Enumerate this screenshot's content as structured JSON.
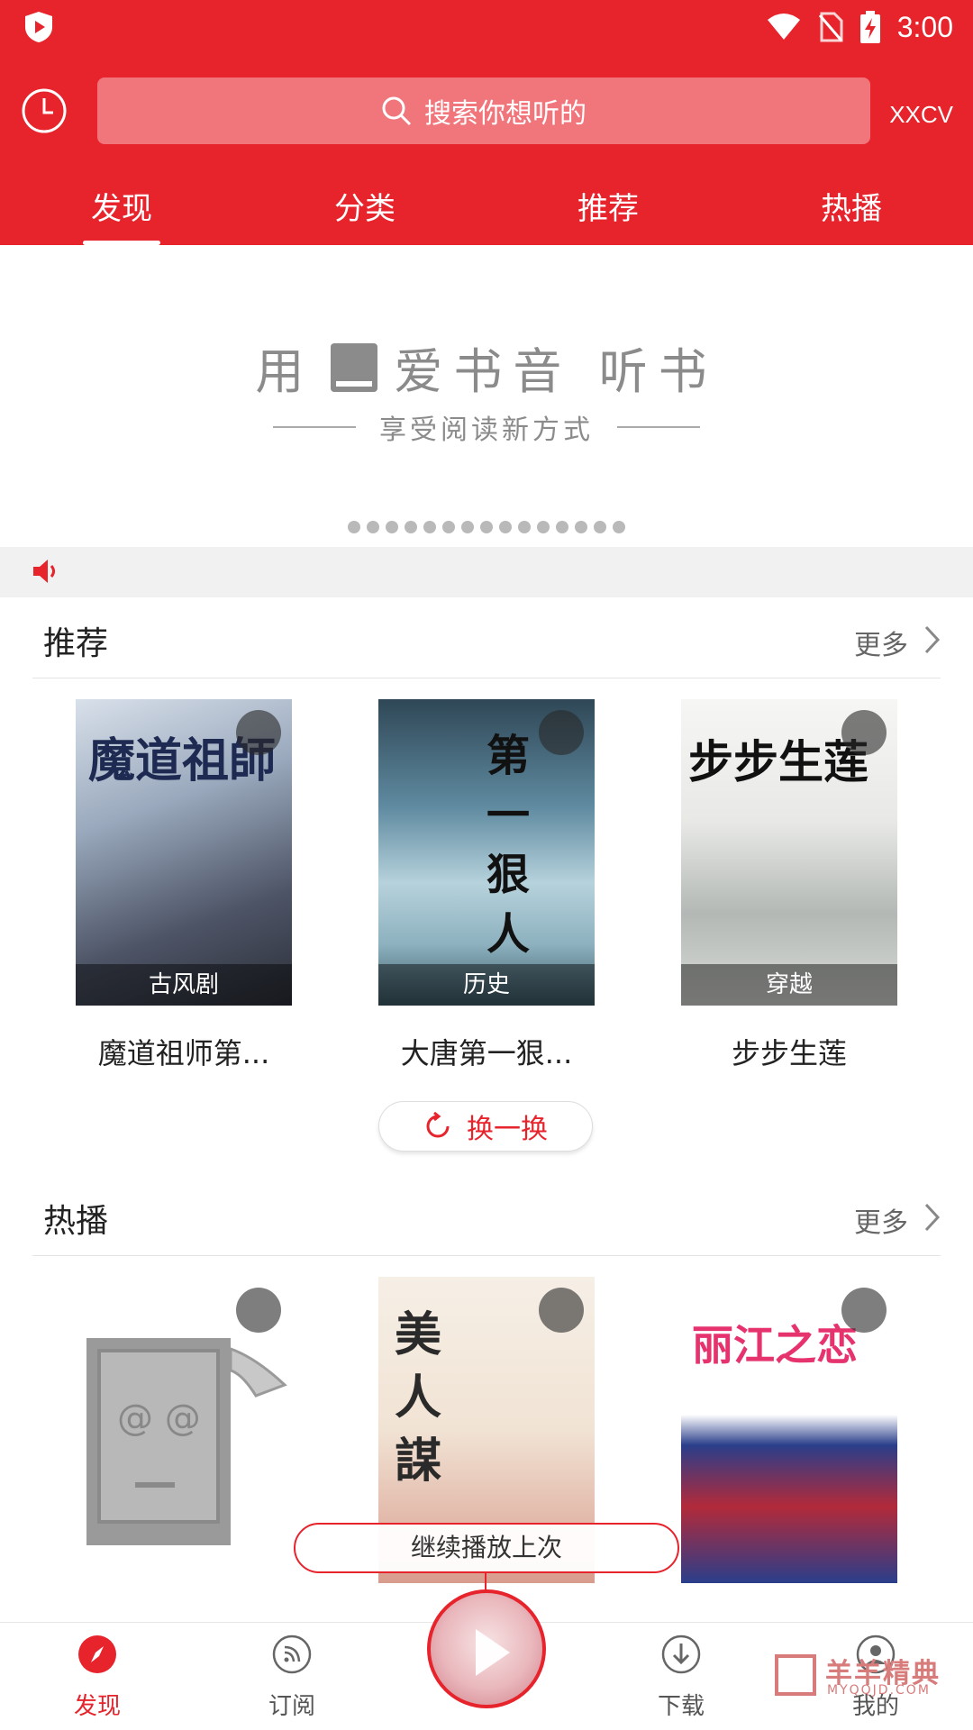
{
  "status_bar": {
    "time": "3:00"
  },
  "header": {
    "search_placeholder": "搜索你想听的",
    "user_label": "XXCV",
    "tabs": [
      {
        "label": "发现",
        "active": true
      },
      {
        "label": "分类",
        "active": false
      },
      {
        "label": "推荐",
        "active": false
      },
      {
        "label": "热播",
        "active": false
      }
    ]
  },
  "banner": {
    "title_left": "用",
    "title_right": "爱书音 听书",
    "subtitle": "享受阅读新方式",
    "dot_count": 15
  },
  "recommend": {
    "title": "推荐",
    "more": "更多",
    "books": [
      {
        "tag": "古风剧",
        "title": "魔道祖师第...",
        "cover_text": "魔道祖師"
      },
      {
        "tag": "历史",
        "title": "大唐第一狠...",
        "cover_text": "第一狠人"
      },
      {
        "tag": "穿越",
        "title": "步步生莲",
        "cover_text": "步步生莲"
      }
    ],
    "refresh_label": "换一换"
  },
  "hot": {
    "title": "热播",
    "more": "更多",
    "books": [
      {
        "cover_text": "@ @"
      },
      {
        "cover_text": "美人謀"
      },
      {
        "cover_text": "丽江之恋"
      }
    ]
  },
  "continue_label": "继续播放上次",
  "bottom_nav": [
    {
      "label": "发现",
      "active": true
    },
    {
      "label": "订阅",
      "active": false
    },
    {
      "label": "下载",
      "active": false
    },
    {
      "label": "我的",
      "active": false
    }
  ],
  "watermark": {
    "title": "羊羊精典",
    "sub": "MYQQJD.COM"
  },
  "colors": {
    "brand_red": "#e7232c",
    "banner_gray": "#8b8b8b"
  }
}
